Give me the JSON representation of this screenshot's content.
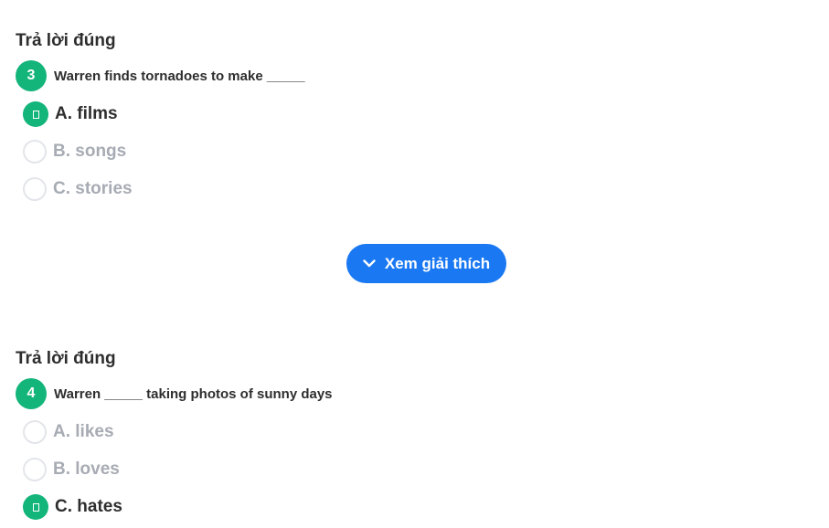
{
  "questions": [
    {
      "status": "Trả lời đúng",
      "number": "3",
      "text": "Warren finds tornadoes to make _____",
      "options": [
        {
          "label": "A. films",
          "selected": true
        },
        {
          "label": "B. songs",
          "selected": false
        },
        {
          "label": "C. stories",
          "selected": false
        }
      ],
      "explain_label": "Xem giải thích"
    },
    {
      "status": "Trả lời đúng",
      "number": "4",
      "text": "Warren _____ taking photos of sunny days",
      "options": [
        {
          "label": "A. likes",
          "selected": false
        },
        {
          "label": "B. loves",
          "selected": false
        },
        {
          "label": "C. hates",
          "selected": true
        }
      ]
    }
  ],
  "colors": {
    "correct": "#13b57a",
    "button": "#1a78f2",
    "text": "#2e2e2e",
    "muted": "#a7abb3"
  },
  "icons": {
    "explain_button": "chevron-down-icon",
    "selected_option": "check-icon"
  }
}
